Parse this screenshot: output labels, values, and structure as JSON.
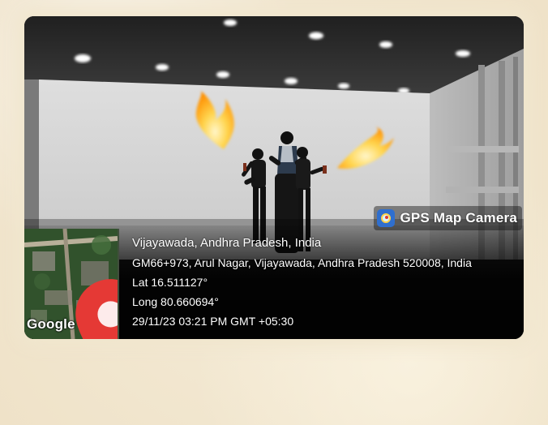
{
  "location": {
    "city": "Vijayawada, Andhra Pradesh, India",
    "address": "GM66+973, Arul Nagar, Vijayawada, Andhra Pradesh 520008, India",
    "lat": "Lat 16.511127°",
    "long": "Long 80.660694°",
    "timestamp": "29/11/23 03:21 PM GMT +05:30"
  },
  "branding": {
    "app_name": "GPS Map Camera",
    "map_provider": "Google"
  },
  "colors": {
    "page_background": "#f1e6cf",
    "overlay_text": "#ffffff",
    "pin": "#e53935",
    "flame_core": "#ffe082",
    "flame_outer": "#ff8f00"
  },
  "icons": {
    "brand": "gps-map-camera-icon",
    "pin": "map-pin-icon"
  }
}
